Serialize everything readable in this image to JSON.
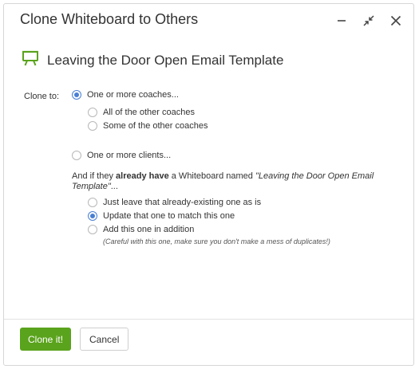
{
  "window": {
    "title": "Clone Whiteboard to Others"
  },
  "heading": {
    "icon": "whiteboard-icon",
    "text": "Leaving the Door Open Email Template",
    "icon_color": "#5aa31c"
  },
  "clone_to": {
    "label": "Clone to:",
    "options": [
      {
        "label": "One or more coaches...",
        "checked": true
      },
      {
        "label": "All of the other coaches",
        "checked": false
      },
      {
        "label": "Some of the other coaches",
        "checked": false
      },
      {
        "label": "One or more clients...",
        "checked": false
      }
    ]
  },
  "question": {
    "prefix": "And if they ",
    "bold": "already have",
    "middle": " a Whiteboard named ",
    "name": "\"Leaving the Door Open Email Template\"",
    "suffix": "..."
  },
  "existing": {
    "options": [
      {
        "label": "Just leave that already-existing one as is",
        "checked": false
      },
      {
        "label": "Update that one to match this one",
        "checked": true
      },
      {
        "label": "Add this one in addition",
        "checked": false
      }
    ],
    "note": "(Careful with this one, make sure you don't make a mess of duplicates!)"
  },
  "footer": {
    "clone_label": "Clone it!",
    "cancel_label": "Cancel"
  },
  "colors": {
    "accent_green": "#5aa31c",
    "radio_blue": "#4a7fd4"
  }
}
